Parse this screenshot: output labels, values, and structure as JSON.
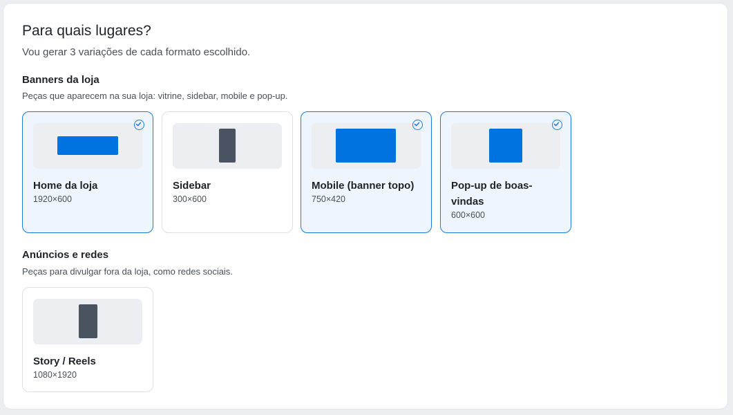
{
  "header": {
    "title": "Para quais lugares?",
    "subtitle": "Vou gerar 3 variações de cada formato escolhido."
  },
  "sections": [
    {
      "title": "Banners da loja",
      "description": "Peças que aparecem na sua loja: vitrine, sidebar, mobile e pop-up.",
      "cards": [
        {
          "label": "Home da loja",
          "dimensions": "1920×600",
          "selected": true,
          "icon": "wide-banner-icon"
        },
        {
          "label": "Sidebar",
          "dimensions": "300×600",
          "selected": false,
          "icon": "vertical-banner-icon"
        },
        {
          "label": "Mobile (banner topo)",
          "dimensions": "750×420",
          "selected": true,
          "icon": "mobile-banner-icon"
        },
        {
          "label": "Pop-up de boas-vindas",
          "dimensions": "600×600",
          "selected": true,
          "icon": "square-banner-icon"
        }
      ]
    },
    {
      "title": "Anúncios e redes",
      "description": "Peças para divulgar fora da loja, como redes sociais.",
      "cards": [
        {
          "label": "Story / Reels",
          "dimensions": "1080×1920",
          "selected": false,
          "icon": "story-format-icon"
        }
      ]
    }
  ],
  "colors": {
    "accent": "#0073e0",
    "selected_border": "#1a7ad9",
    "selected_background": "#eef5fc",
    "unselected_shape": "#4a5361"
  }
}
